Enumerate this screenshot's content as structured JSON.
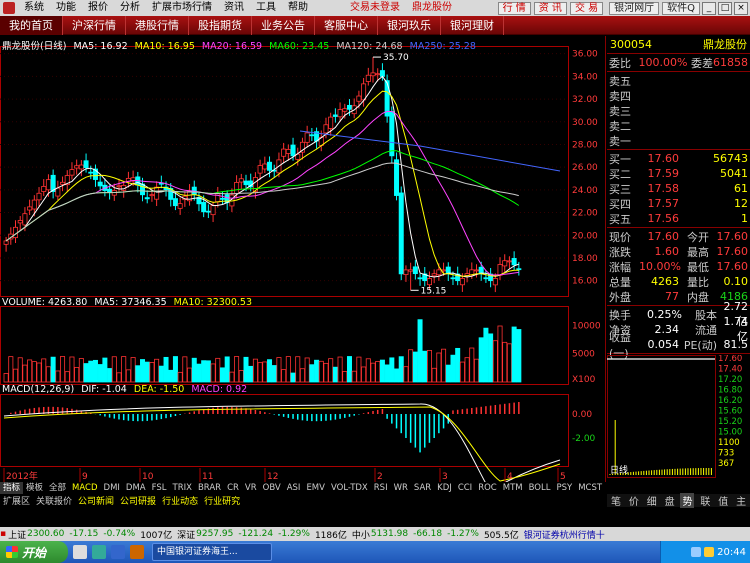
{
  "menubar": {
    "items": [
      "系统",
      "功能",
      "报价",
      "分析",
      "扩展市场行情",
      "资讯",
      "工具",
      "帮助"
    ],
    "trade_login": "交易未登录",
    "stock_name": "鼎龙股份",
    "buttons": [
      "行 情",
      "资 讯",
      "交 易"
    ],
    "hall_button": "银河网厅",
    "soft_button": "软件Q"
  },
  "navbar": {
    "tabs": [
      "我的首页",
      "沪深行情",
      "港股行情",
      "股指期货",
      "业务公告",
      "客服中心",
      "银河玖乐",
      "银河理财"
    ]
  },
  "chart": {
    "title": "鼎龙股份(日线)",
    "ma": [
      {
        "label": "MA5: 16.92",
        "color": "#ffffff"
      },
      {
        "label": "MA10: 16.95",
        "color": "#ffff00"
      },
      {
        "label": "MA20: 16.59",
        "color": "#ff44ff"
      },
      {
        "label": "MA60: 23.45",
        "color": "#00ff00"
      },
      {
        "label": "MA120: 24.68",
        "color": "#cccccc"
      },
      {
        "label": "MA250: 25.28",
        "color": "#4466ff"
      }
    ],
    "price_axis": [
      "36.00",
      "34.00",
      "32.00",
      "30.00",
      "28.00",
      "26.00",
      "24.00",
      "22.00",
      "20.00",
      "18.00",
      "16.00"
    ],
    "high_label": "35.70",
    "low_label": "15.15",
    "volume_line": {
      "vol": "VOLUME: 4263.80",
      "ma5": "MA5: 37346.35",
      "ma10": "MA10: 32300.53"
    },
    "volume_axis": [
      "10000",
      "5000",
      "X100"
    ],
    "macd_line": {
      "name": "MACD(12,26,9)",
      "dif": "DIF: -1.04",
      "dea": "DEA: -1.50",
      "macd": "MACD: 0.92"
    },
    "macd_axis": [
      "0.00",
      "-2.00"
    ],
    "time_axis": [
      "2012年",
      "9",
      "10",
      "11",
      "12",
      "2",
      "3",
      "4",
      "5"
    ],
    "colors": {
      "up": "#ff3232",
      "down": "#00ffff",
      "frame": "#aa0000"
    }
  },
  "quote": {
    "code": "300054",
    "name": "鼎龙股份",
    "weibi_label": "委比",
    "weibi_value": "100.00%",
    "weicha_label": "委差",
    "weicha_value": "61858",
    "sell": [
      {
        "label": "卖五",
        "price": "",
        "vol": ""
      },
      {
        "label": "卖四",
        "price": "",
        "vol": ""
      },
      {
        "label": "卖三",
        "price": "",
        "vol": ""
      },
      {
        "label": "卖二",
        "price": "",
        "vol": ""
      },
      {
        "label": "卖一",
        "price": "",
        "vol": ""
      }
    ],
    "buy": [
      {
        "label": "买一",
        "price": "17.60",
        "vol": "56743"
      },
      {
        "label": "买二",
        "price": "17.59",
        "vol": "5041"
      },
      {
        "label": "买三",
        "price": "17.58",
        "vol": "61"
      },
      {
        "label": "买四",
        "price": "17.57",
        "vol": "12"
      },
      {
        "label": "买五",
        "price": "17.56",
        "vol": "1"
      }
    ],
    "stats": [
      {
        "l1": "现价",
        "v1": "17.60",
        "l2": "今开",
        "v2": "17.60",
        "c1": "red",
        "c2": "red"
      },
      {
        "l1": "涨跌",
        "v1": "1.60",
        "l2": "最高",
        "v2": "17.60",
        "c1": "red",
        "c2": "red"
      },
      {
        "l1": "涨幅",
        "v1": "10.00%",
        "l2": "最低",
        "v2": "17.60",
        "c1": "red",
        "c2": "red"
      },
      {
        "l1": "总量",
        "v1": "4263",
        "l2": "量比",
        "v2": "0.10",
        "c1": "yellow",
        "c2": "yellow"
      },
      {
        "l1": "外盘",
        "v1": "77",
        "l2": "内盘",
        "v2": "4186",
        "c1": "red",
        "c2": "green"
      }
    ],
    "fund": [
      {
        "l1": "换手",
        "v1": "0.25%",
        "l2": "股本",
        "v2": "2.72亿"
      },
      {
        "l1": "净资",
        "v1": "2.34",
        "l2": "流通",
        "v2": "1.74亿"
      },
      {
        "l1": "收益(一)",
        "v1": "0.054",
        "l2": "PE(动)",
        "v2": "81.5"
      }
    ],
    "mini_axis": [
      "17.60",
      "17.40",
      "17.20",
      "16.80",
      "16.20",
      "15.60",
      "15.20",
      "15.00",
      "1100",
      "733",
      "367"
    ],
    "mini_label": "日线"
  },
  "ind_tabs": [
    "指标",
    "模板",
    "全部",
    "MACD",
    "DMI",
    "DMA",
    "FSL",
    "TRIX",
    "BRAR",
    "CR",
    "VR",
    "OBV",
    "ASI",
    "EMV",
    "VOL-TDX",
    "RSI",
    "WR",
    "SAR",
    "KDJ",
    "CCI",
    "ROC",
    "MTM",
    "BOLL",
    "PSY",
    "MCST"
  ],
  "ext_tabs": [
    "扩展区",
    "关联报价",
    "公司新闻",
    "公司研报",
    "行业动态",
    "行业研究"
  ],
  "side_tabs": [
    "笔",
    "价",
    "细",
    "盘",
    "势",
    "联",
    "值",
    "主"
  ],
  "status": {
    "sh_label": "上证",
    "sh_value": "2300.60",
    "sh_chg": "-17.15",
    "sh_pct": "-0.74%",
    "sh_amt": "1007亿",
    "sz_label": "深证",
    "sz_value": "9257.95",
    "sz_chg": "-121.24",
    "sz_pct": "-1.29%",
    "sz_amt": "1186亿",
    "zx_label": "中小",
    "zx_value": "5131.98",
    "zx_chg": "-66.18",
    "zx_pct": "-1.27%",
    "zx_amt": "505.5亿",
    "broker": "银河证券杭州行情十"
  },
  "taskbar": {
    "start": "开始",
    "task": "中国银河证券海王...",
    "clock": "20:44"
  }
}
